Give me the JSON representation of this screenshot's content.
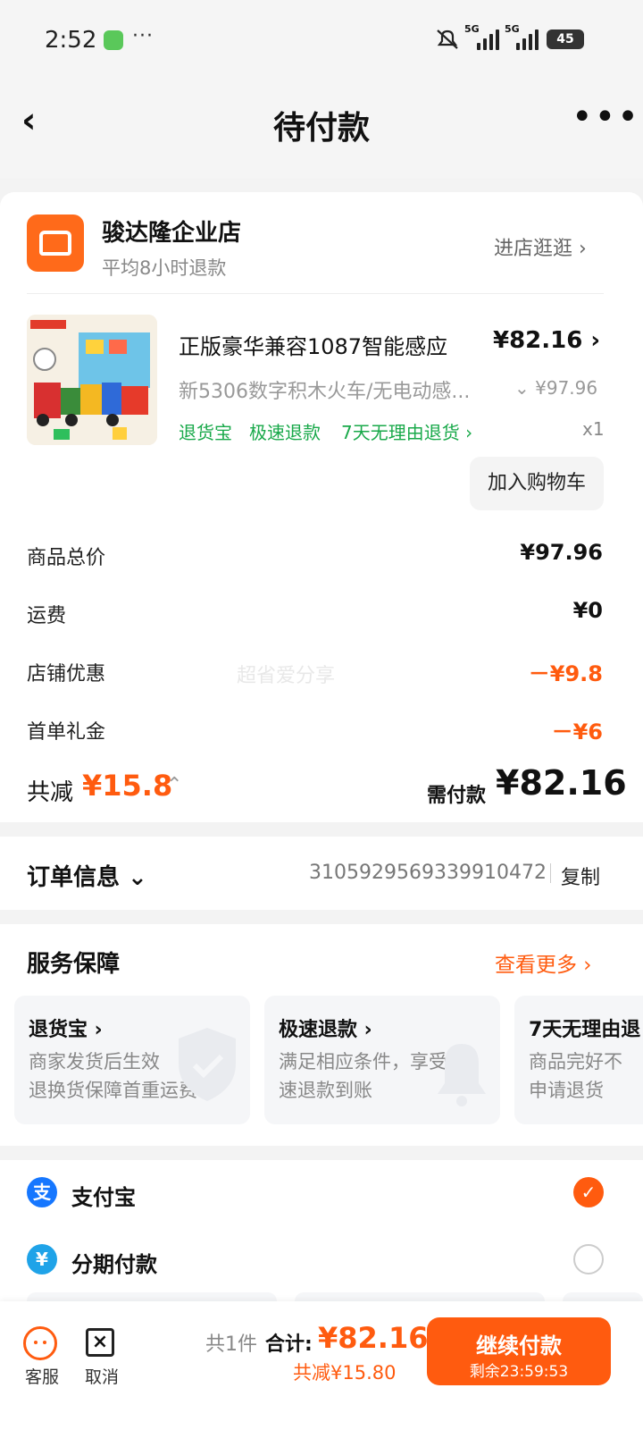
{
  "status_bar": {
    "time": "2:52",
    "more": "···",
    "signal1": "5G",
    "signal2": "5G",
    "battery": "45"
  },
  "header": {
    "title": "待付款",
    "back": "‹",
    "more": "•••"
  },
  "store": {
    "name": "骏达隆企业店",
    "sub": "平均8小时退款",
    "enter": "进店逛逛 ›"
  },
  "product": {
    "title": "正版豪华兼容1087智能感应",
    "price": "¥82.16 ›",
    "spec": "新5306数字积木火车/无电动感...",
    "orig_price": "⌄ ¥97.96",
    "tags": [
      "退货宝",
      "极速退款",
      "7天无理由退货 ›"
    ],
    "qty": "x1",
    "add_cart": "加入购物车"
  },
  "summary": {
    "rows": [
      {
        "label": "商品总价",
        "value": "¥97.96"
      },
      {
        "label": "运费",
        "value": "¥0"
      },
      {
        "label": "店铺优惠",
        "value": "－¥9.8"
      },
      {
        "label": "首单礼金",
        "value": "－¥6"
      }
    ],
    "watermark": "超省爱分享",
    "saved_label": "共减",
    "saved_amount": "¥15.8",
    "need_label": "需付款",
    "need_amount": "¥82.16"
  },
  "order": {
    "label": "订单信息 ⌄",
    "number": "3105929569339910472",
    "copy": "复制"
  },
  "service": {
    "title": "服务保障",
    "more": "查看更多 ›",
    "items": [
      {
        "title": "退货宝 ›",
        "desc1": "商家发货后生效",
        "desc2": "退换货保障首重运费"
      },
      {
        "title": "极速退款 ›",
        "desc1": "满足相应条件，享受极",
        "desc2": "速退款到账"
      },
      {
        "title": "7天无理由退",
        "desc1": "商品完好不",
        "desc2": "申请退货"
      }
    ]
  },
  "payment": {
    "options": [
      {
        "label": "支付宝",
        "icon": "支",
        "selected": true
      },
      {
        "label": "分期付款",
        "icon": "¥",
        "selected": false
      }
    ]
  },
  "bottom": {
    "kefu": "客服",
    "cancel": "取消",
    "count": "共1件",
    "total_label": "合计:",
    "total_amount": "¥82.16",
    "saved": "共减¥15.80",
    "pay_button": "继续付款",
    "countdown": "剩余23:59:53"
  },
  "colors": {
    "accent": "#ff5b0f",
    "green": "#19a94a",
    "brand_store": "#ff6a1a"
  }
}
